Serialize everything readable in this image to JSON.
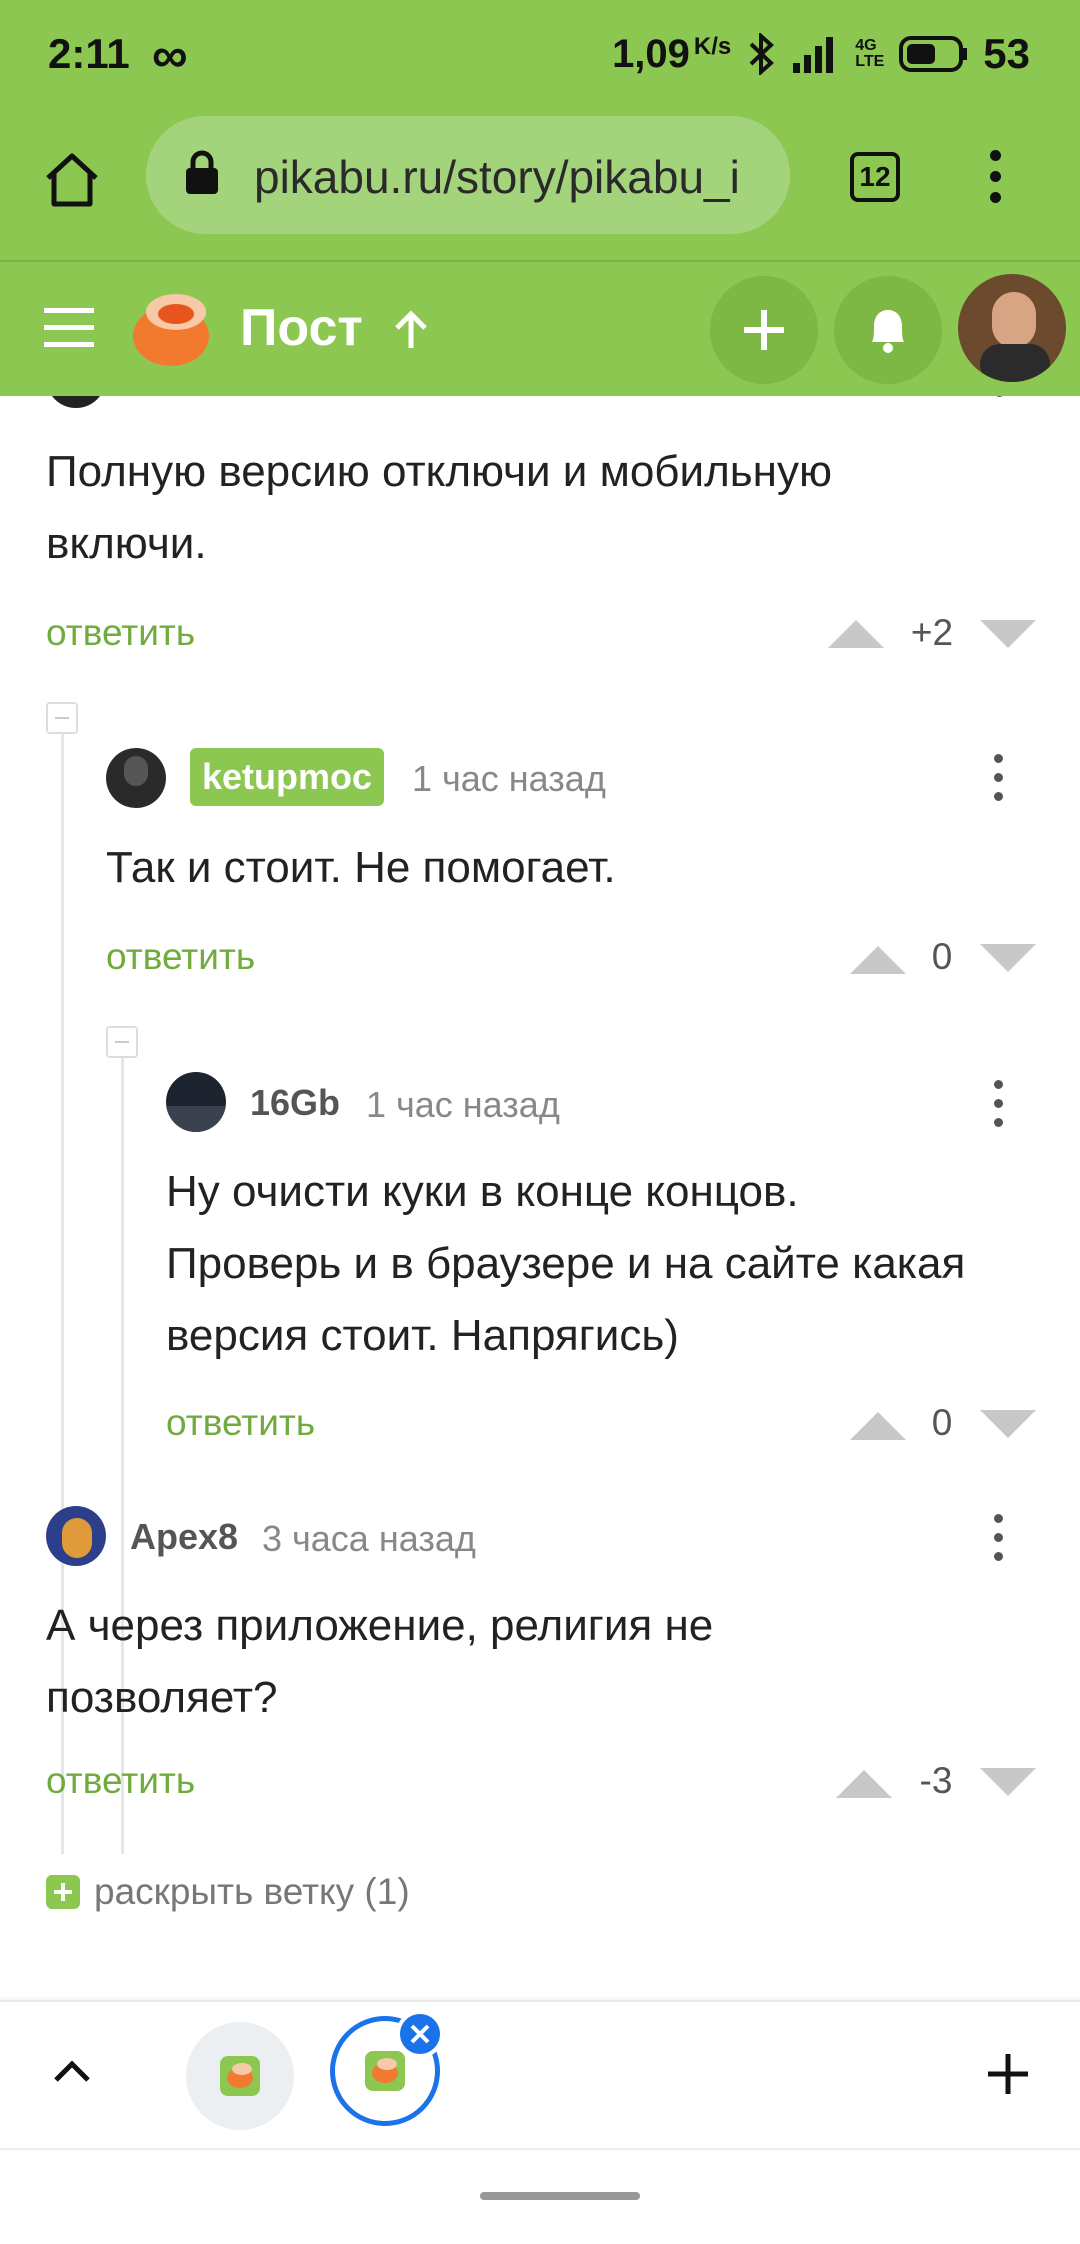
{
  "status": {
    "time": "2:11",
    "speed": "1,09",
    "speed_unit": "K/s",
    "network": "4G LTE",
    "battery": "53"
  },
  "browser": {
    "url": "pikabu.ru/story/pikabu_i",
    "tab_count": "12"
  },
  "appbar": {
    "title": "Пост"
  },
  "comments": [
    {
      "text": "Полную версию отключи и мобильную включи.",
      "reply": "ответить",
      "score": "+2"
    },
    {
      "author": "ketupmoc",
      "time": "1 час назад",
      "text": "Так и стоит. Не помогает.",
      "reply": "ответить",
      "score": "0"
    },
    {
      "author": "16Gb",
      "time": "1 час назад",
      "text": "Ну очисти куки в конце концов. Проверь и в браузере и на сайте какая версия стоит. Напрягись)",
      "reply": "ответить",
      "score": "0"
    },
    {
      "author": "Apex8",
      "time": "3 часа назад",
      "text": "А через приложение, религия не позволяет?",
      "reply": "ответить",
      "score": "-3"
    }
  ],
  "expand": {
    "label": "раскрыть ветку (1)"
  },
  "colors": {
    "brand_green": "#8cc751",
    "reply_green": "#6fac3d",
    "text": "#222222"
  }
}
